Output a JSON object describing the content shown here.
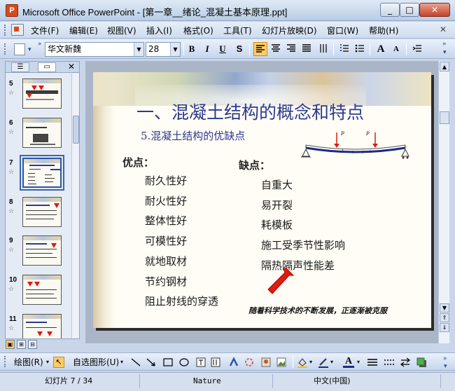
{
  "window": {
    "title": "Microsoft Office PowerPoint - [第一章__绪论_混凝土基本原理.ppt]",
    "app_icon_letter": "P"
  },
  "menu": [
    "文件(F)",
    "编辑(E)",
    "视图(V)",
    "插入(I)",
    "格式(O)",
    "工具(T)",
    "幻灯片放映(D)",
    "窗口(W)",
    "帮助(H)"
  ],
  "toolbar": {
    "font": "华文新魏",
    "font_size": "28",
    "bold": "B",
    "italic": "I",
    "underline": "U",
    "shadow": "S",
    "grow": "A",
    "shrink": "A"
  },
  "slides_pane": {
    "items": [
      {
        "num": "5",
        "star": "☆"
      },
      {
        "num": "6",
        "star": "☆"
      },
      {
        "num": "7",
        "star": "☆",
        "selected": true
      },
      {
        "num": "8",
        "star": "☆"
      },
      {
        "num": "9",
        "star": "☆"
      },
      {
        "num": "10",
        "star": "☆"
      },
      {
        "num": "11",
        "star": "☆"
      }
    ]
  },
  "slide": {
    "title": "一、混凝土结构的概念和特点",
    "subtitle": "5.混凝土结构的优缺点",
    "pros_head": "优点：",
    "pros": [
      "耐久性好",
      "耐火性好",
      "整体性好",
      "可模性好",
      "就地取材",
      "节约钢材",
      "阻止射线的穿透"
    ],
    "cons_head": "缺点：",
    "cons": [
      "自重大",
      "易开裂",
      "耗模板",
      "施工受季节性影响",
      "隔热隔声性能差"
    ],
    "note": "随着科学技术的不断发展，正逐渐被克服",
    "beam_labels": [
      "P",
      "P"
    ]
  },
  "drawing_toolbar": {
    "draw": "绘图(R)",
    "autoshapes": "自选图形(U)"
  },
  "status": {
    "slide_count": "幻灯片 7 / 34",
    "design": "Nature",
    "language": "中文(中国)"
  }
}
